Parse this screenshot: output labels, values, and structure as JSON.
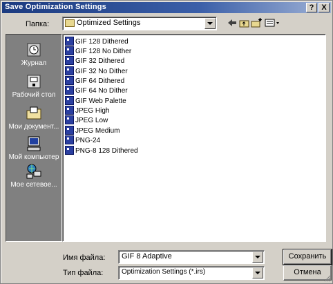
{
  "window": {
    "title": "Save Optimization Settings",
    "help_glyph": "?",
    "close_glyph": "X"
  },
  "folder_bar": {
    "label": "Папка:",
    "current_folder": "Optimized Settings",
    "folder_icon": "folder-icon",
    "tools": {
      "back": "back-arrow-icon",
      "up": "up-folder-icon",
      "new_folder": "new-folder-icon",
      "view_menu": "view-menu-icon"
    }
  },
  "places": [
    {
      "label": "Журнал",
      "icon": "history-icon"
    },
    {
      "label": "Рабочий стол",
      "icon": "desktop-icon"
    },
    {
      "label": "Мои документ...",
      "icon": "my-documents-icon"
    },
    {
      "label": "Мой компьютер",
      "icon": "my-computer-icon"
    },
    {
      "label": "Мое сетевое...",
      "icon": "network-places-icon"
    }
  ],
  "files": [
    "GIF 128 Dithered",
    "GIF 128 No Dither",
    "GIF 32 Dithered",
    "GIF 32 No Dither",
    "GIF 64 Dithered",
    "GIF 64 No Dither",
    "GIF Web Palette",
    "JPEG High",
    "JPEG Low",
    "JPEG Medium",
    "PNG-24",
    "PNG-8 128 Dithered"
  ],
  "filename": {
    "label": "Имя файла:",
    "value": "GIF 8 Adaptive"
  },
  "filetype": {
    "label": "Тип файла:",
    "value": "Optimization Settings (*.irs)"
  },
  "buttons": {
    "save": "Сохранить",
    "cancel": "Отмена"
  },
  "colors": {
    "title_start": "#1c3b80",
    "face": "#d4d0c8",
    "places_bg": "#808080",
    "file_icon": "#2b3fa0"
  }
}
